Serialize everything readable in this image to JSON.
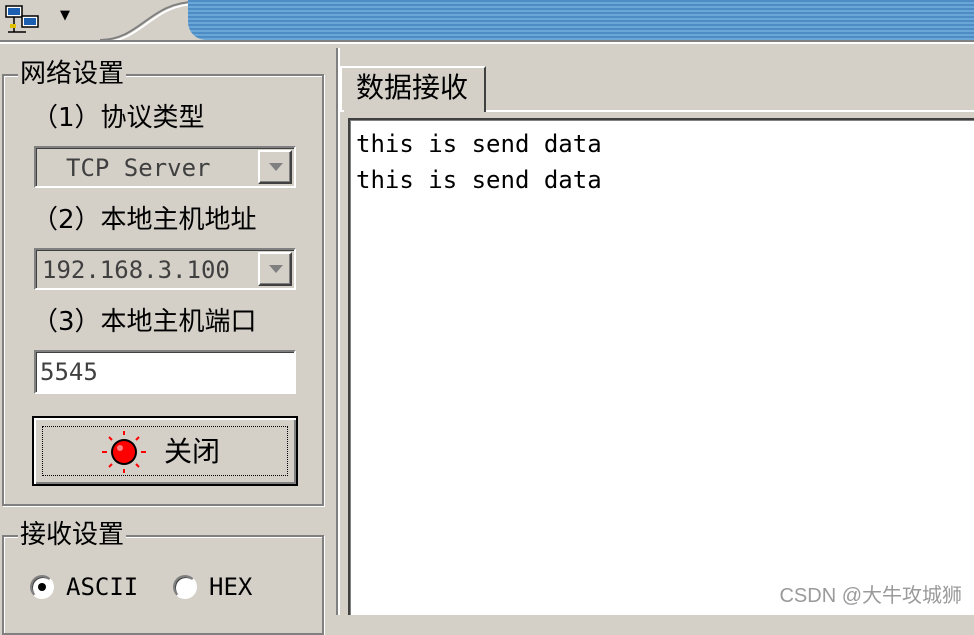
{
  "titlebar": {
    "icons": {
      "system": "network-computer-icon",
      "dropdown": "dropdown-arrow-icon"
    },
    "accent_color": "#5b9bd5"
  },
  "network_settings": {
    "title": "网络设置",
    "protocol": {
      "label": "（1）协议类型",
      "value": "TCP Server"
    },
    "local_ip": {
      "label": "（2）本地主机地址",
      "value": "192.168.3.100"
    },
    "local_port": {
      "label": "（3）本地主机端口",
      "value": "5545"
    },
    "close_button": {
      "label": "关闭",
      "icon": "red-led-icon",
      "led_color": "#ff0000"
    }
  },
  "receive_settings": {
    "title": "接收设置",
    "options": [
      {
        "label": "ASCII",
        "selected": true
      },
      {
        "label": "HEX",
        "selected": false
      }
    ]
  },
  "receive_tab": {
    "label": "数据接收",
    "lines": [
      "this is send data",
      "this is send data"
    ]
  },
  "watermark": "CSDN @大牛攻城狮"
}
